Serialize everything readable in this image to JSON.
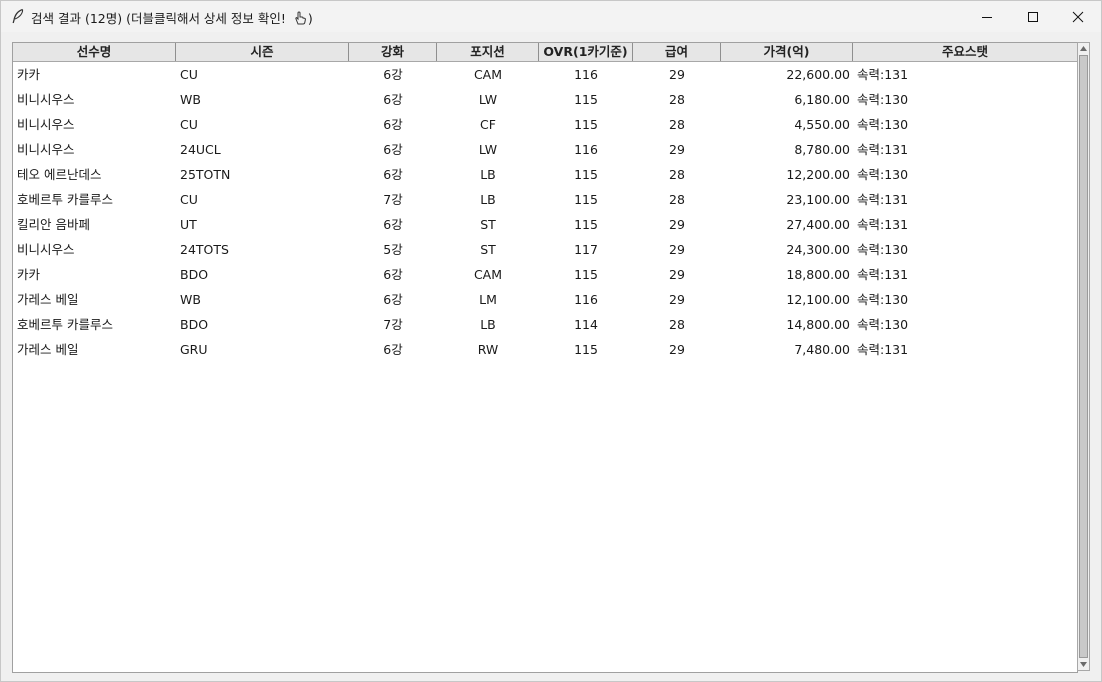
{
  "window": {
    "title": "검색 결과 (12명) (더블클릭해서 상세 정보 확인! ",
    "title_icon": "feather-icon",
    "title_emoji": "pointing-hand-icon"
  },
  "columns": [
    "선수명",
    "시즌",
    "강화",
    "포지션",
    "OVR(1카기준)",
    "급여",
    "가격(억)",
    "주요스탯"
  ],
  "rows": [
    {
      "name": "카카",
      "season": "CU",
      "grade": "6강",
      "position": "CAM",
      "ovr": "116",
      "salary": "29",
      "price": "22,600.00",
      "stat": "속력:131"
    },
    {
      "name": "비니시우스",
      "season": "WB",
      "grade": "6강",
      "position": "LW",
      "ovr": "115",
      "salary": "28",
      "price": "6,180.00",
      "stat": "속력:130"
    },
    {
      "name": "비니시우스",
      "season": "CU",
      "grade": "6강",
      "position": "CF",
      "ovr": "115",
      "salary": "28",
      "price": "4,550.00",
      "stat": "속력:130"
    },
    {
      "name": "비니시우스",
      "season": "24UCL",
      "grade": "6강",
      "position": "LW",
      "ovr": "116",
      "salary": "29",
      "price": "8,780.00",
      "stat": "속력:131"
    },
    {
      "name": "테오 에르난데스",
      "season": "25TOTN",
      "grade": "6강",
      "position": "LB",
      "ovr": "115",
      "salary": "28",
      "price": "12,200.00",
      "stat": "속력:130"
    },
    {
      "name": "호베르투 카를루스",
      "season": "CU",
      "grade": "7강",
      "position": "LB",
      "ovr": "115",
      "salary": "28",
      "price": "23,100.00",
      "stat": "속력:131"
    },
    {
      "name": "킬리안 음바페",
      "season": "UT",
      "grade": "6강",
      "position": "ST",
      "ovr": "115",
      "salary": "29",
      "price": "27,400.00",
      "stat": "속력:131"
    },
    {
      "name": "비니시우스",
      "season": "24TOTS",
      "grade": "5강",
      "position": "ST",
      "ovr": "117",
      "salary": "29",
      "price": "24,300.00",
      "stat": "속력:130"
    },
    {
      "name": "카카",
      "season": "BDO",
      "grade": "6강",
      "position": "CAM",
      "ovr": "115",
      "salary": "29",
      "price": "18,800.00",
      "stat": "속력:131"
    },
    {
      "name": "가레스 베일",
      "season": "WB",
      "grade": "6강",
      "position": "LM",
      "ovr": "116",
      "salary": "29",
      "price": "12,100.00",
      "stat": "속력:130"
    },
    {
      "name": "호베르투 카를루스",
      "season": "BDO",
      "grade": "7강",
      "position": "LB",
      "ovr": "114",
      "salary": "28",
      "price": "14,800.00",
      "stat": "속력:130"
    },
    {
      "name": "가레스 베일",
      "season": "GRU",
      "grade": "6강",
      "position": "RW",
      "ovr": "115",
      "salary": "29",
      "price": "7,480.00",
      "stat": "속력:131"
    }
  ]
}
